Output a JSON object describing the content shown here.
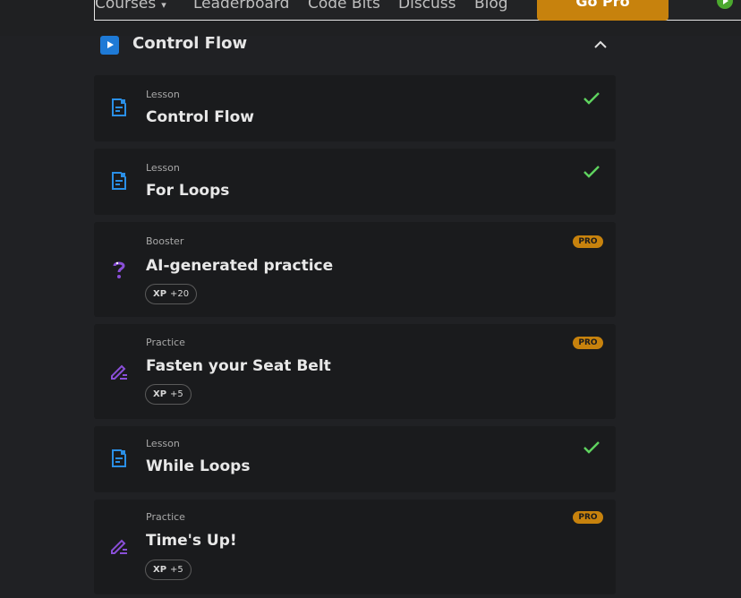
{
  "nav": {
    "links": [
      "Courses",
      "Leaderboard",
      "Code Bits",
      "Discuss",
      "Blog"
    ],
    "gopro_label": "Go Pro"
  },
  "module": {
    "title": "Control Flow"
  },
  "items": [
    {
      "type": "Lesson",
      "title": "Control Flow",
      "completed": true,
      "icon": "lesson-doc-icon"
    },
    {
      "type": "Lesson",
      "title": "For Loops",
      "completed": true,
      "icon": "lesson-doc-icon"
    },
    {
      "type": "Booster",
      "title": "AI-generated practice",
      "pro": "PRO",
      "xp_label": "XP",
      "xp_value": "+20",
      "icon": "question-icon"
    },
    {
      "type": "Practice",
      "title": "Fasten your Seat Belt",
      "pro": "PRO",
      "xp_label": "XP",
      "xp_value": "+5",
      "icon": "pencil-icon"
    },
    {
      "type": "Lesson",
      "title": "While Loops",
      "completed": true,
      "icon": "lesson-doc-icon"
    },
    {
      "type": "Practice",
      "title": "Time's Up!",
      "pro": "PRO",
      "xp_label": "XP",
      "xp_value": "+5",
      "icon": "pencil-icon"
    }
  ],
  "colors": {
    "background": "#202124",
    "card": "#1a1b1d",
    "accent_blue": "#1e7ad6",
    "pro_orange": "#c7820d",
    "check_green": "#5fd35f",
    "booster_purple": "#8a4fd8"
  }
}
